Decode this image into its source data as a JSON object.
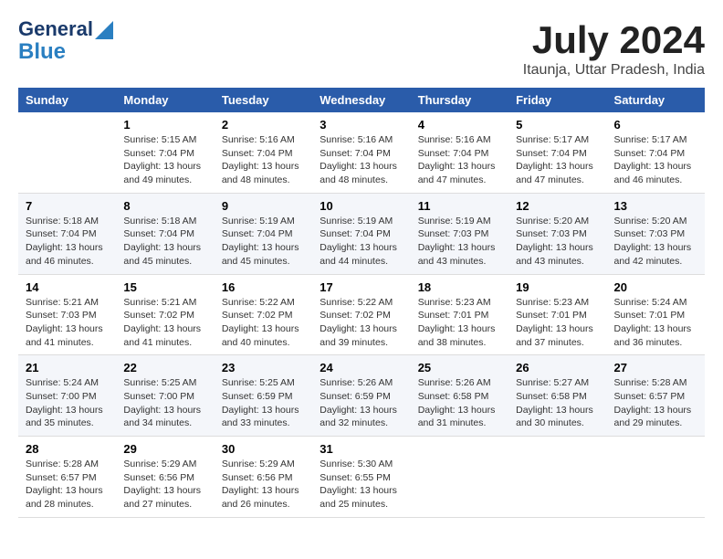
{
  "logo": {
    "line1": "General",
    "line2": "Blue"
  },
  "title": {
    "month_year": "July 2024",
    "location": "Itaunja, Uttar Pradesh, India"
  },
  "weekdays": [
    "Sunday",
    "Monday",
    "Tuesday",
    "Wednesday",
    "Thursday",
    "Friday",
    "Saturday"
  ],
  "weeks": [
    [
      {
        "day": "",
        "sunrise": "",
        "sunset": "",
        "daylight": ""
      },
      {
        "day": "1",
        "sunrise": "Sunrise: 5:15 AM",
        "sunset": "Sunset: 7:04 PM",
        "daylight": "Daylight: 13 hours and 49 minutes."
      },
      {
        "day": "2",
        "sunrise": "Sunrise: 5:16 AM",
        "sunset": "Sunset: 7:04 PM",
        "daylight": "Daylight: 13 hours and 48 minutes."
      },
      {
        "day": "3",
        "sunrise": "Sunrise: 5:16 AM",
        "sunset": "Sunset: 7:04 PM",
        "daylight": "Daylight: 13 hours and 48 minutes."
      },
      {
        "day": "4",
        "sunrise": "Sunrise: 5:16 AM",
        "sunset": "Sunset: 7:04 PM",
        "daylight": "Daylight: 13 hours and 47 minutes."
      },
      {
        "day": "5",
        "sunrise": "Sunrise: 5:17 AM",
        "sunset": "Sunset: 7:04 PM",
        "daylight": "Daylight: 13 hours and 47 minutes."
      },
      {
        "day": "6",
        "sunrise": "Sunrise: 5:17 AM",
        "sunset": "Sunset: 7:04 PM",
        "daylight": "Daylight: 13 hours and 46 minutes."
      }
    ],
    [
      {
        "day": "7",
        "sunrise": "Sunrise: 5:18 AM",
        "sunset": "Sunset: 7:04 PM",
        "daylight": "Daylight: 13 hours and 46 minutes."
      },
      {
        "day": "8",
        "sunrise": "Sunrise: 5:18 AM",
        "sunset": "Sunset: 7:04 PM",
        "daylight": "Daylight: 13 hours and 45 minutes."
      },
      {
        "day": "9",
        "sunrise": "Sunrise: 5:19 AM",
        "sunset": "Sunset: 7:04 PM",
        "daylight": "Daylight: 13 hours and 45 minutes."
      },
      {
        "day": "10",
        "sunrise": "Sunrise: 5:19 AM",
        "sunset": "Sunset: 7:04 PM",
        "daylight": "Daylight: 13 hours and 44 minutes."
      },
      {
        "day": "11",
        "sunrise": "Sunrise: 5:19 AM",
        "sunset": "Sunset: 7:03 PM",
        "daylight": "Daylight: 13 hours and 43 minutes."
      },
      {
        "day": "12",
        "sunrise": "Sunrise: 5:20 AM",
        "sunset": "Sunset: 7:03 PM",
        "daylight": "Daylight: 13 hours and 43 minutes."
      },
      {
        "day": "13",
        "sunrise": "Sunrise: 5:20 AM",
        "sunset": "Sunset: 7:03 PM",
        "daylight": "Daylight: 13 hours and 42 minutes."
      }
    ],
    [
      {
        "day": "14",
        "sunrise": "Sunrise: 5:21 AM",
        "sunset": "Sunset: 7:03 PM",
        "daylight": "Daylight: 13 hours and 41 minutes."
      },
      {
        "day": "15",
        "sunrise": "Sunrise: 5:21 AM",
        "sunset": "Sunset: 7:02 PM",
        "daylight": "Daylight: 13 hours and 41 minutes."
      },
      {
        "day": "16",
        "sunrise": "Sunrise: 5:22 AM",
        "sunset": "Sunset: 7:02 PM",
        "daylight": "Daylight: 13 hours and 40 minutes."
      },
      {
        "day": "17",
        "sunrise": "Sunrise: 5:22 AM",
        "sunset": "Sunset: 7:02 PM",
        "daylight": "Daylight: 13 hours and 39 minutes."
      },
      {
        "day": "18",
        "sunrise": "Sunrise: 5:23 AM",
        "sunset": "Sunset: 7:01 PM",
        "daylight": "Daylight: 13 hours and 38 minutes."
      },
      {
        "day": "19",
        "sunrise": "Sunrise: 5:23 AM",
        "sunset": "Sunset: 7:01 PM",
        "daylight": "Daylight: 13 hours and 37 minutes."
      },
      {
        "day": "20",
        "sunrise": "Sunrise: 5:24 AM",
        "sunset": "Sunset: 7:01 PM",
        "daylight": "Daylight: 13 hours and 36 minutes."
      }
    ],
    [
      {
        "day": "21",
        "sunrise": "Sunrise: 5:24 AM",
        "sunset": "Sunset: 7:00 PM",
        "daylight": "Daylight: 13 hours and 35 minutes."
      },
      {
        "day": "22",
        "sunrise": "Sunrise: 5:25 AM",
        "sunset": "Sunset: 7:00 PM",
        "daylight": "Daylight: 13 hours and 34 minutes."
      },
      {
        "day": "23",
        "sunrise": "Sunrise: 5:25 AM",
        "sunset": "Sunset: 6:59 PM",
        "daylight": "Daylight: 13 hours and 33 minutes."
      },
      {
        "day": "24",
        "sunrise": "Sunrise: 5:26 AM",
        "sunset": "Sunset: 6:59 PM",
        "daylight": "Daylight: 13 hours and 32 minutes."
      },
      {
        "day": "25",
        "sunrise": "Sunrise: 5:26 AM",
        "sunset": "Sunset: 6:58 PM",
        "daylight": "Daylight: 13 hours and 31 minutes."
      },
      {
        "day": "26",
        "sunrise": "Sunrise: 5:27 AM",
        "sunset": "Sunset: 6:58 PM",
        "daylight": "Daylight: 13 hours and 30 minutes."
      },
      {
        "day": "27",
        "sunrise": "Sunrise: 5:28 AM",
        "sunset": "Sunset: 6:57 PM",
        "daylight": "Daylight: 13 hours and 29 minutes."
      }
    ],
    [
      {
        "day": "28",
        "sunrise": "Sunrise: 5:28 AM",
        "sunset": "Sunset: 6:57 PM",
        "daylight": "Daylight: 13 hours and 28 minutes."
      },
      {
        "day": "29",
        "sunrise": "Sunrise: 5:29 AM",
        "sunset": "Sunset: 6:56 PM",
        "daylight": "Daylight: 13 hours and 27 minutes."
      },
      {
        "day": "30",
        "sunrise": "Sunrise: 5:29 AM",
        "sunset": "Sunset: 6:56 PM",
        "daylight": "Daylight: 13 hours and 26 minutes."
      },
      {
        "day": "31",
        "sunrise": "Sunrise: 5:30 AM",
        "sunset": "Sunset: 6:55 PM",
        "daylight": "Daylight: 13 hours and 25 minutes."
      },
      {
        "day": "",
        "sunrise": "",
        "sunset": "",
        "daylight": ""
      },
      {
        "day": "",
        "sunrise": "",
        "sunset": "",
        "daylight": ""
      },
      {
        "day": "",
        "sunrise": "",
        "sunset": "",
        "daylight": ""
      }
    ]
  ]
}
